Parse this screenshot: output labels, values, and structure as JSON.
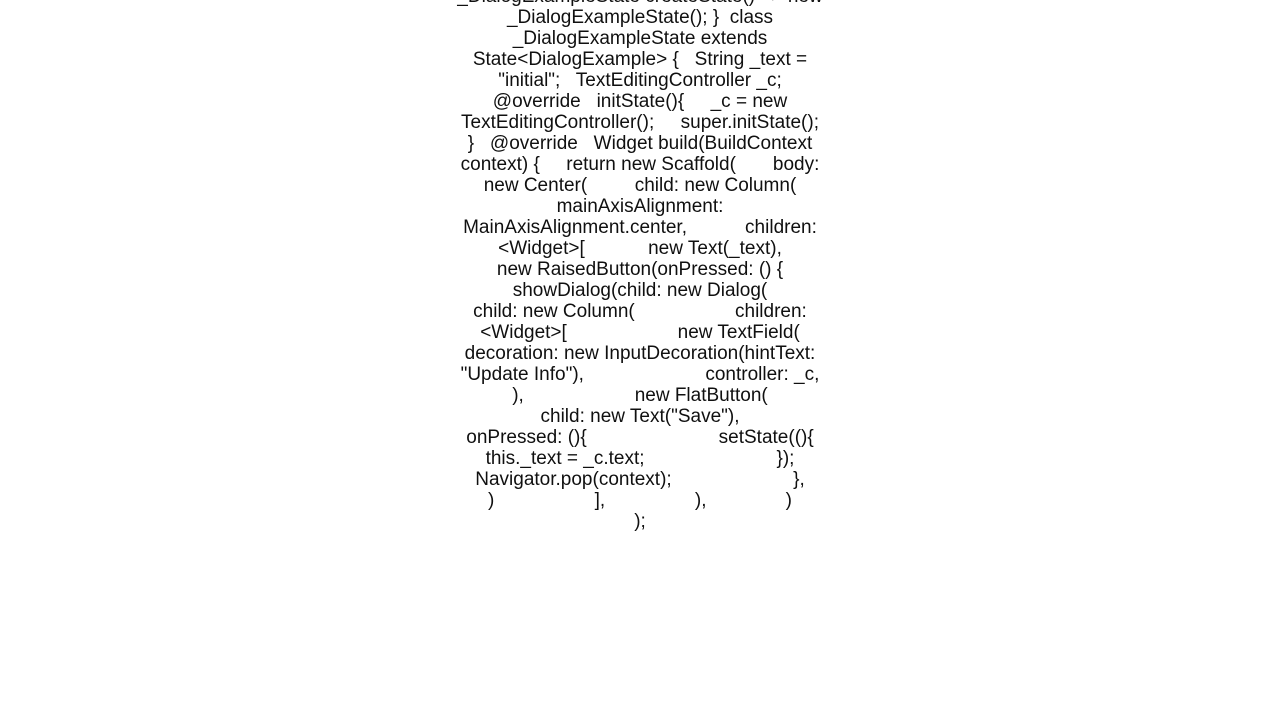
{
  "code": {
    "text": "_DialogExampleState createState() => new _DialogExampleState(); }  class _DialogExampleState extends State<DialogExample> {   String _text = \"initial\";   TextEditingController _c;   @override   initState(){     _c = new TextEditingController();     super.initState();   }   @override   Widget build(BuildContext context) {     return new Scaffold(       body: new Center(         child: new Column(           mainAxisAlignment: MainAxisAlignment.center,           children: <Widget>[            new Text(_text),             new RaisedButton(onPressed: () {               showDialog(child: new Dialog(                 child: new Column(                   children: <Widget>[                     new TextField(                       decoration: new InputDecoration(hintText: \"Update Info\"),                       controller: _c,                      ),                     new FlatButton(                       child: new Text(\"Save\"),                       onPressed: (){                         setState((){                           this._text = _c.text;                         });                         Navigator.pop(context);                       },                     )                   ],                 ),               )                );"
  }
}
